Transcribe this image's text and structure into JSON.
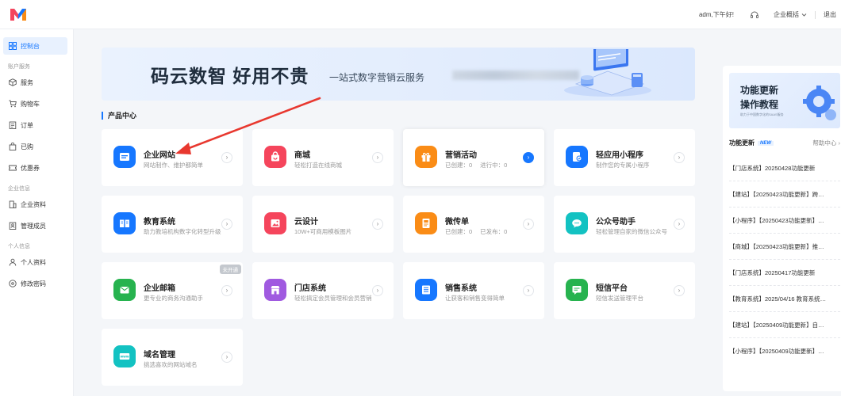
{
  "header": {
    "greeting": "adm,下午好!",
    "overview_label": "企业概括",
    "logout_label": "退出"
  },
  "sidebar": {
    "items": [
      {
        "label": "控制台",
        "icon": "dashboard-icon",
        "active": true
      },
      {
        "group": "账户服务"
      },
      {
        "label": "服务",
        "icon": "box-icon"
      },
      {
        "label": "购物车",
        "icon": "cart-icon"
      },
      {
        "label": "订单",
        "icon": "order-icon"
      },
      {
        "label": "已购",
        "icon": "bag-icon"
      },
      {
        "label": "优惠券",
        "icon": "coupon-icon"
      },
      {
        "group": "企业信息"
      },
      {
        "label": "企业资料",
        "icon": "building-icon"
      },
      {
        "label": "管理成员",
        "icon": "members-icon"
      },
      {
        "group": "个人信息"
      },
      {
        "label": "个人资料",
        "icon": "user-icon"
      },
      {
        "label": "修改密码",
        "icon": "lock-icon"
      }
    ]
  },
  "banner": {
    "title": "码云数智  好用不贵",
    "subtitle": "一站式数字营销云服务"
  },
  "products": {
    "section_title": "产品中心",
    "cards": [
      {
        "title": "企业网站",
        "desc": "网站制作、维护都简单",
        "icon": "website-icon",
        "color": "#1677ff"
      },
      {
        "title": "商城",
        "desc": "轻松打造在线商城",
        "icon": "shop-bag-icon",
        "color": "#f5455c"
      },
      {
        "title": "营销活动",
        "stats": [
          "已创建：0",
          "进行中：0"
        ],
        "icon": "gift-icon",
        "color": "#fa8c16"
      },
      {
        "title": "轻应用小程序",
        "desc": "制作您的专属小程序",
        "icon": "mini-program-icon",
        "color": "#1677ff"
      },
      {
        "title": "教育系统",
        "desc": "助力教培机构数字化转型升级",
        "icon": "book-icon",
        "color": "#1677ff"
      },
      {
        "title": "云设计",
        "desc": "10W+可商用模板图片",
        "icon": "image-icon",
        "color": "#f5455c"
      },
      {
        "title": "微传单",
        "stats": [
          "已创建：0",
          "已发布：0"
        ],
        "icon": "flyer-icon",
        "color": "#fa8c16"
      },
      {
        "title": "公众号助手",
        "desc": "轻松管理自家的微信公众号",
        "icon": "wechat-icon",
        "color": "#13c2c2"
      },
      {
        "title": "企业邮箱",
        "desc": "更专业的商务沟通助手",
        "icon": "mail-icon",
        "color": "#27b34f",
        "tag": "未开通"
      },
      {
        "title": "门店系统",
        "desc": "轻松搞定会员管理和会员营销",
        "icon": "store-icon",
        "color": "#a05ae0"
      },
      {
        "title": "销售系统",
        "desc": "让获客和销售变得简单",
        "icon": "list-icon",
        "color": "#1677ff"
      },
      {
        "title": "短信平台",
        "desc": "短信发送管理平台",
        "icon": "sms-icon",
        "color": "#27b34f"
      },
      {
        "title": "域名管理",
        "desc": "挑选喜欢的网站域名",
        "icon": "domain-icon",
        "color": "#13c2c2"
      }
    ]
  },
  "updates": {
    "banner_title_1": "功能更新",
    "banner_title_2": "操作教程",
    "banner_small": "助力于中国数字化的SAAS服务",
    "heading": "功能更新",
    "new_badge": "NEW",
    "help_label": "帮助中心",
    "items": [
      "【门店系统】20250428功能更新",
      "【建站】【20250423功能更新】跨…",
      "【小程序】【20250423功能更新】…",
      "【商城】【20250423功能更新】推…",
      "【门店系统】20250417功能更新",
      "【教育系统】2025/04/16 教育系统…",
      "【建站】【20250409功能更新】自…",
      "【小程序】【20250409功能更新】…"
    ]
  }
}
